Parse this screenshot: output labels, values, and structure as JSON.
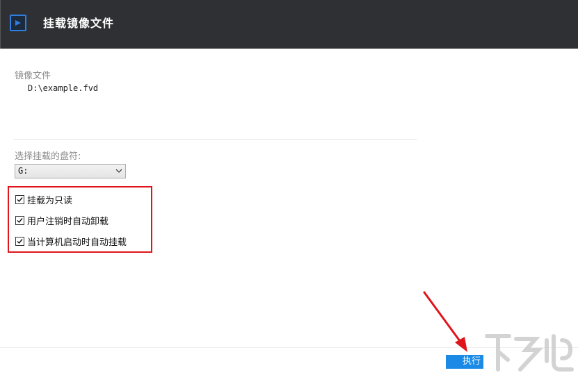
{
  "window": {
    "title": "挂载镜像文件",
    "icon": "play-icon",
    "colors": {
      "titlebar": "#2e3033",
      "accent": "#1a8ae6",
      "highlight": "#e0141b"
    }
  },
  "image_file": {
    "label": "镜像文件",
    "path": "D:\\example.fvd"
  },
  "drive": {
    "label": "选择挂载的盘符:",
    "selected": "G:"
  },
  "options": [
    {
      "label": "挂载为只读",
      "checked": true
    },
    {
      "label": "用户注销时自动卸载",
      "checked": true
    },
    {
      "label": "当计算机启动时自动挂载",
      "checked": true
    }
  ],
  "footer": {
    "execute_label": "执行"
  }
}
